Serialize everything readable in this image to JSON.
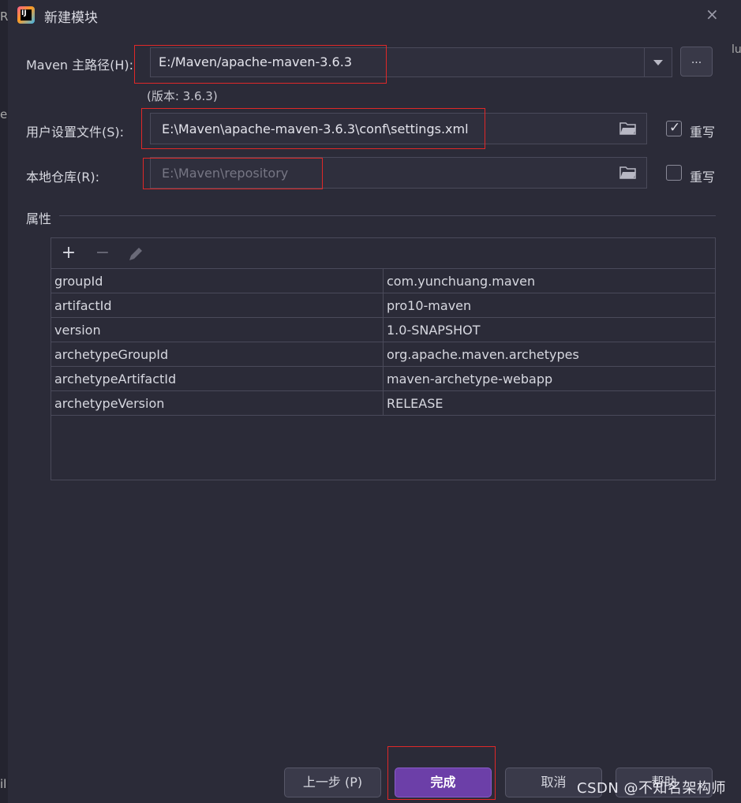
{
  "dialog": {
    "title": "新建模块",
    "close_icon": "×"
  },
  "maven_home": {
    "label": "Maven 主路径(H):",
    "value": "E:/Maven/apache-maven-3.6.3",
    "browse_label": "...",
    "version_note": "(版本: 3.6.3)"
  },
  "user_settings": {
    "label": "用户设置文件(S):",
    "value": "E:\\Maven\\apache-maven-3.6.3\\conf\\settings.xml",
    "override_label": "重写",
    "override_checked": true
  },
  "local_repo": {
    "label": "本地仓库(R):",
    "value": "E:\\Maven\\repository",
    "override_label": "重写",
    "override_checked": false
  },
  "properties": {
    "section_title": "属性",
    "toolbar": {
      "add": "+",
      "remove": "−"
    },
    "rows": [
      {
        "key": "groupId",
        "value": "com.yunchuang.maven"
      },
      {
        "key": "artifactId",
        "value": "pro10-maven"
      },
      {
        "key": "version",
        "value": "1.0-SNAPSHOT"
      },
      {
        "key": "archetypeGroupId",
        "value": "org.apache.maven.archetypes"
      },
      {
        "key": "archetypeArtifactId",
        "value": "maven-archetype-webapp"
      },
      {
        "key": "archetypeVersion",
        "value": "RELEASE"
      }
    ]
  },
  "footer": {
    "prev_label": "上一步 (P)",
    "finish_label": "完成",
    "cancel_label": "取消",
    "help_label": "帮助"
  },
  "watermark": "CSDN @不知名架构师",
  "background_fragments": {
    "top_left": "R",
    "mid_left": "e",
    "bottom_left": "il",
    "top_right": "lu"
  },
  "colors": {
    "accent": "#6c3fa8",
    "highlight_box": "#e02828",
    "background": "#2b2b38"
  },
  "icons": [
    "intellij-icon",
    "close-icon",
    "chevron-down-icon",
    "folder-icon",
    "checkbox-icon",
    "plus-icon",
    "minus-icon",
    "edit-icon"
  ]
}
